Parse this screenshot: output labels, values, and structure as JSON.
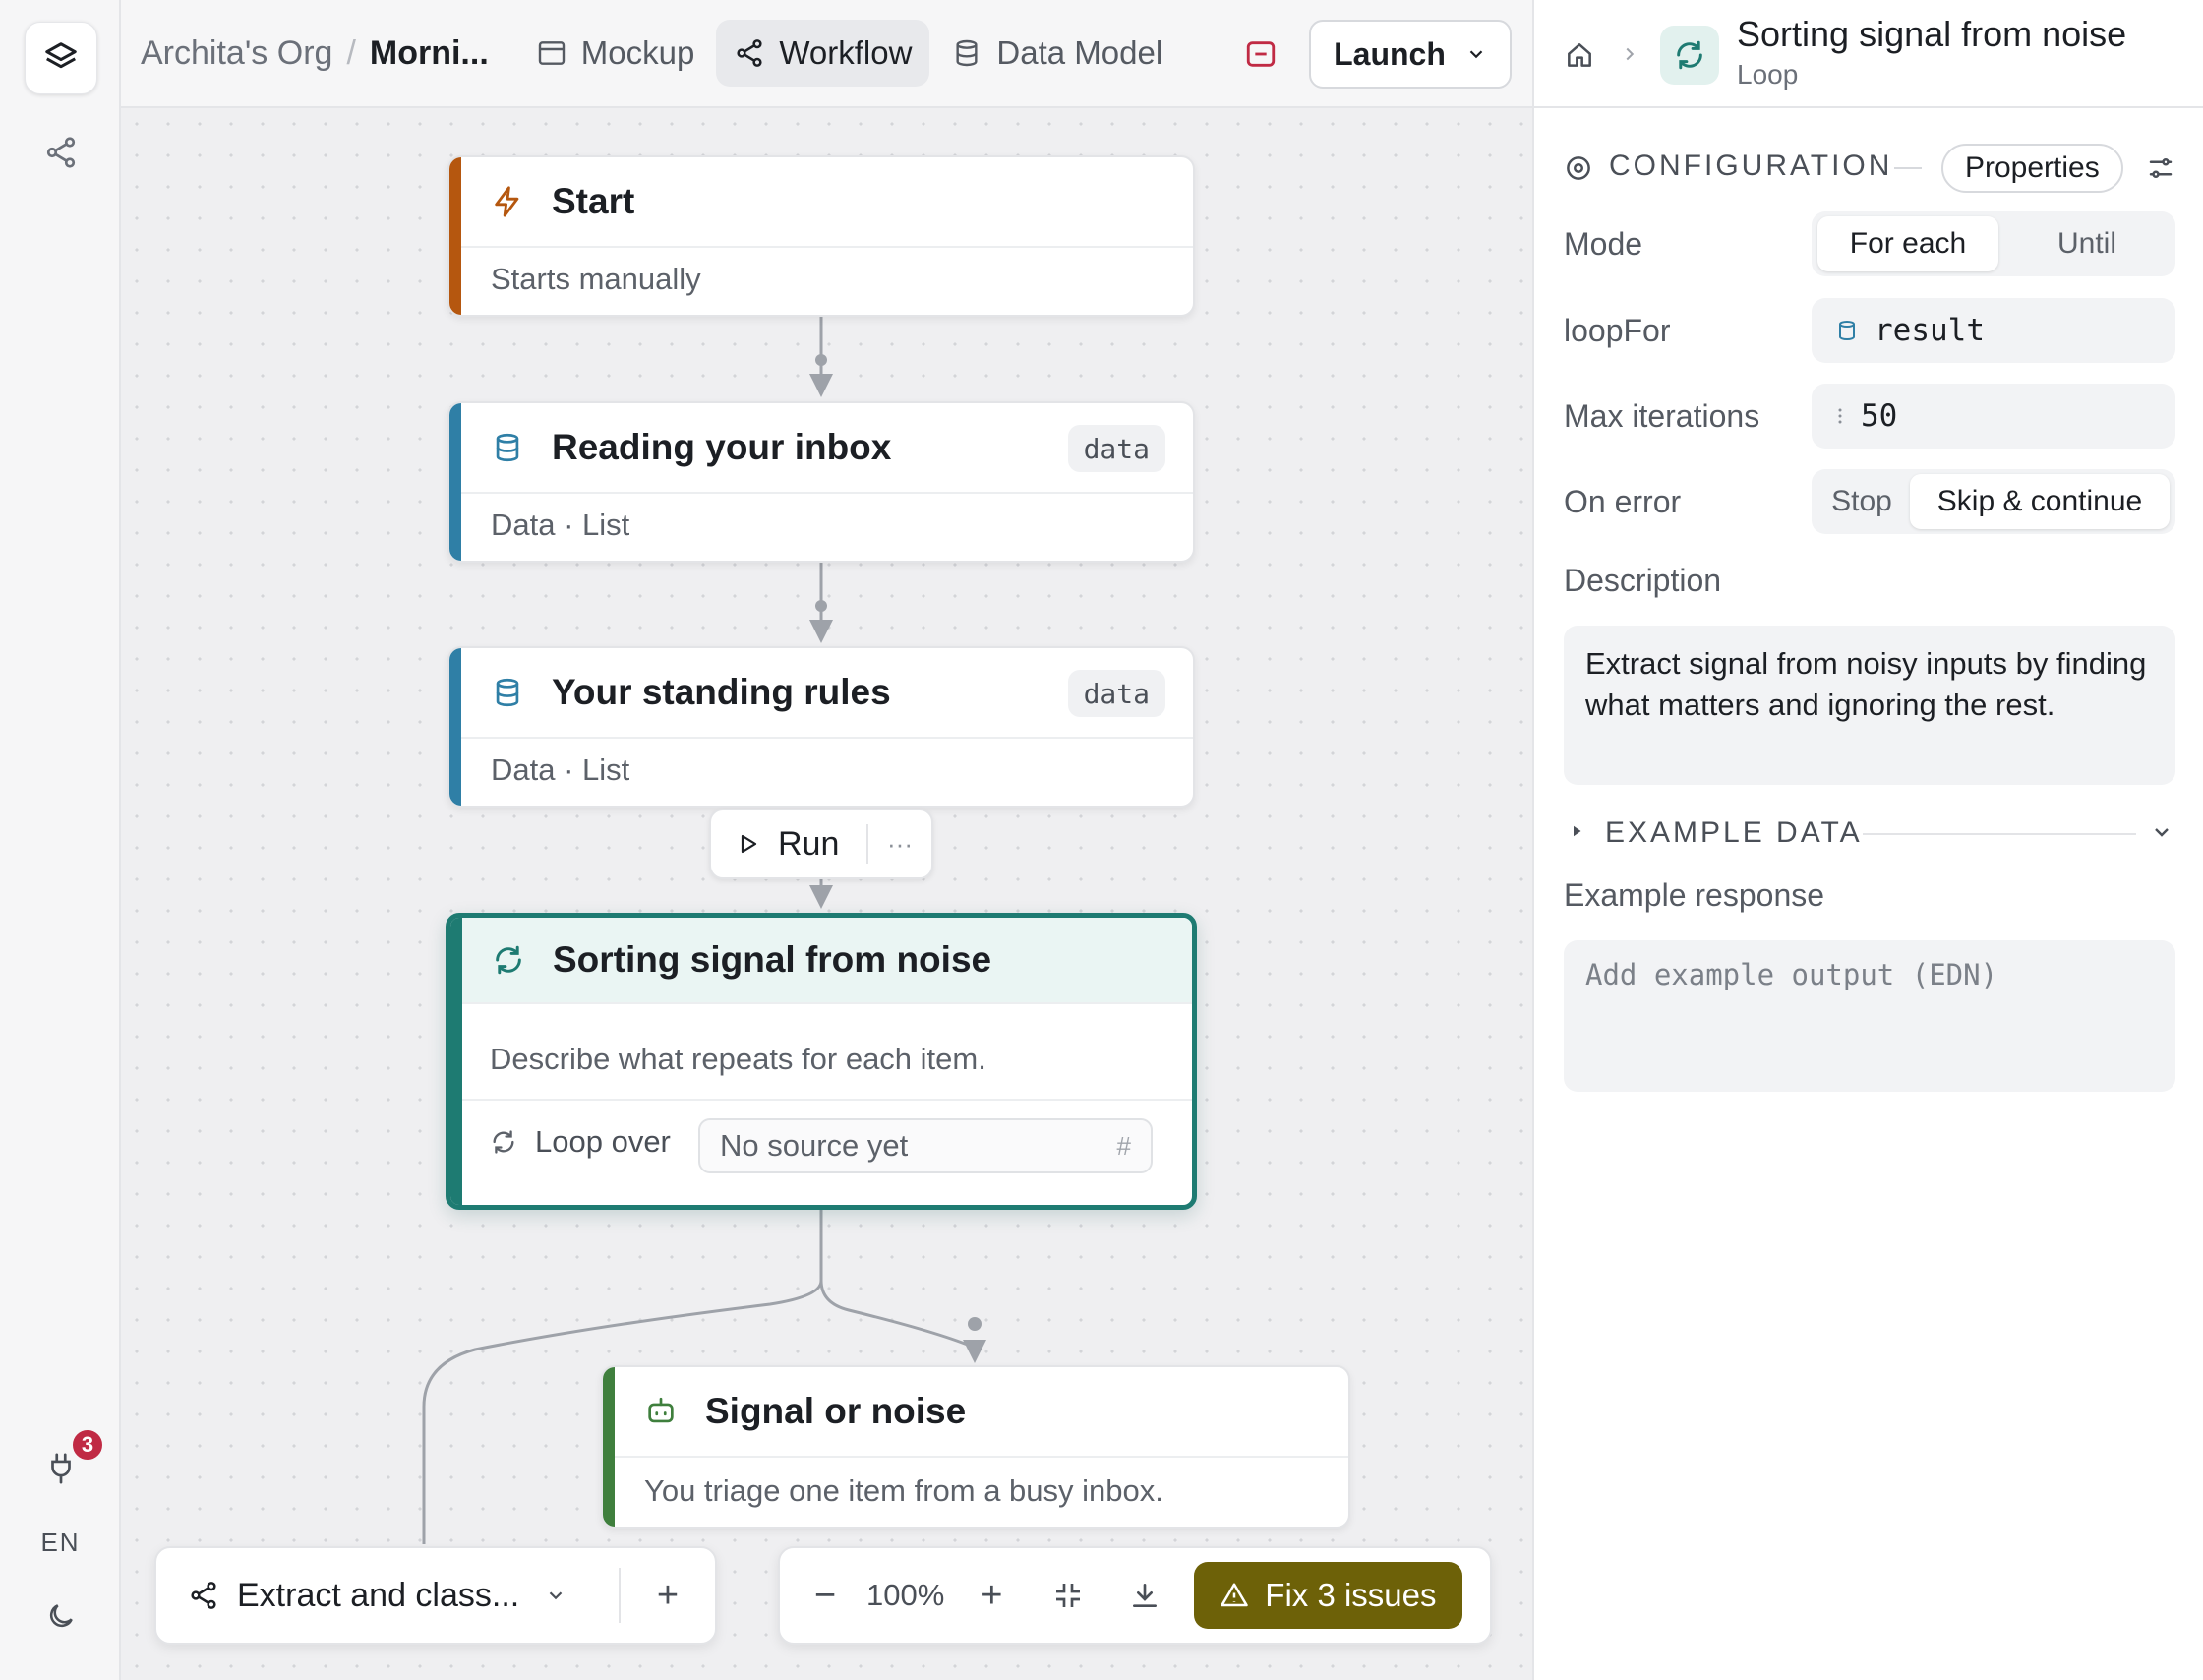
{
  "breadcrumb": {
    "org": "Archita's Org",
    "separator": "/",
    "project": "Morni..."
  },
  "tabs": [
    {
      "label": "Mockup"
    },
    {
      "label": "Workflow"
    },
    {
      "label": "Data Model"
    }
  ],
  "launch_label": "Launch",
  "rail": {
    "badge_count": "3",
    "language": "EN"
  },
  "nodes": {
    "start": {
      "title": "Start",
      "subtitle": "Starts manually"
    },
    "inbox": {
      "title": "Reading your inbox",
      "tag": "data",
      "subtitle": "Data · List"
    },
    "rules": {
      "title": "Your standing rules",
      "tag": "data",
      "subtitle": "Data · List"
    },
    "loop": {
      "title": "Sorting signal from noise",
      "description": "Describe what repeats for each item.",
      "loop_label": "Loop over",
      "loop_placeholder": "No source yet",
      "loop_hash": "#"
    },
    "signal": {
      "title": "Signal or noise",
      "subtitle": "You triage one item from a busy inbox."
    }
  },
  "run_popover": {
    "label": "Run",
    "more": "···"
  },
  "flow_selector": {
    "label": "Extract and class...",
    "add": "+"
  },
  "zoom": {
    "minus": "−",
    "level": "100%",
    "plus": "+"
  },
  "fix_label": "Fix 3 issues",
  "panel": {
    "title": "Sorting signal from noise",
    "subtitle": "Loop",
    "config_title": "CONFIGURATION",
    "properties_label": "Properties",
    "mode_label": "Mode",
    "mode_options": [
      "For each",
      "Until"
    ],
    "mode_selected": "For each",
    "loopfor_label": "loopFor",
    "loopfor_value": "result",
    "max_label": "Max iterations",
    "max_value": "50",
    "onerror_label": "On error",
    "onerror_options": [
      "Stop",
      "Skip & continue"
    ],
    "onerror_selected": "Skip & continue",
    "description_label": "Description",
    "description_text": "Extract signal from noisy inputs by finding what matters and ignoring the rest.",
    "example_title": "EXAMPLE DATA",
    "example_response_label": "Example response",
    "example_placeholder": "Add example output (EDN)"
  },
  "colors": {
    "start_accent": "#b5570f",
    "data_accent": "#2f7fa6",
    "loop_accent": "#1e7b72",
    "signal_accent": "#3f7f3d",
    "fix_bg": "#6d6108",
    "badge_bg": "#c02a44"
  }
}
